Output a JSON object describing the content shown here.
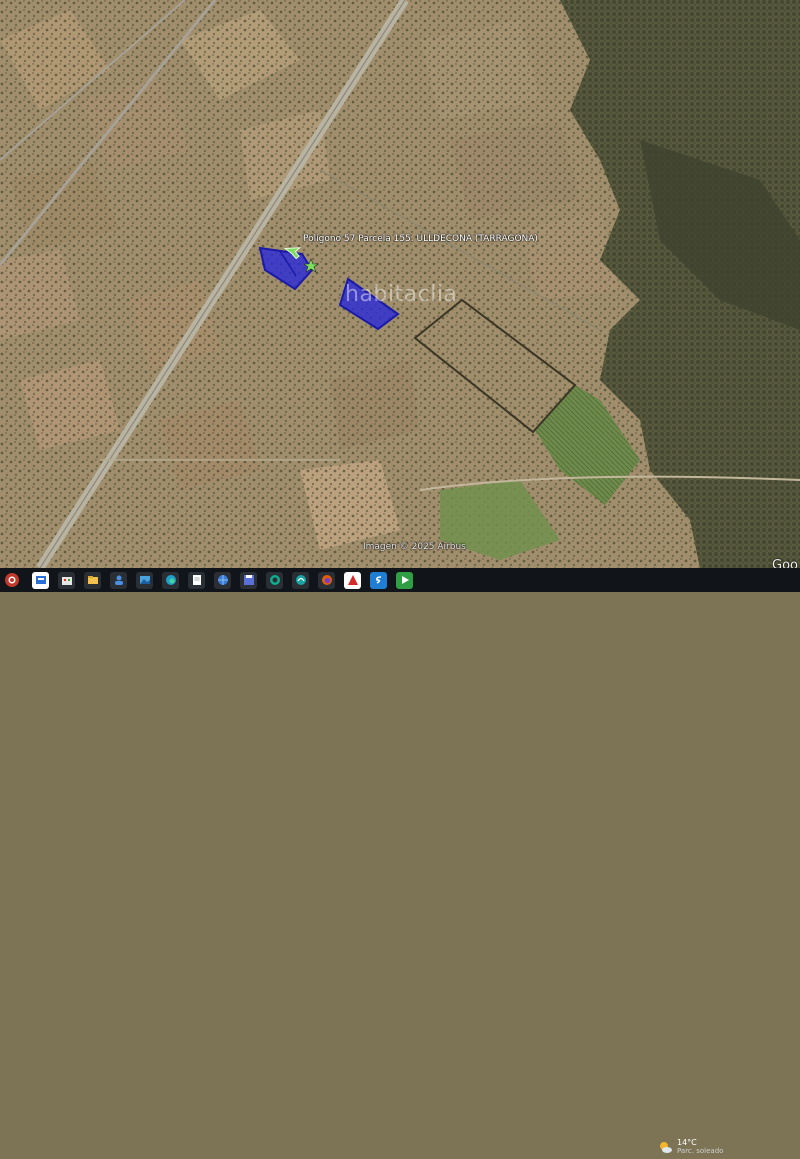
{
  "map": {
    "parcel_label": "Polígono 57 Parcela 155. ULLDECONA (TARRAGONA)",
    "watermark": "habitaclia",
    "imagery_credit": "Imagen © 2025 Airbus",
    "provider_mark": "Goo",
    "parcel_fill_color": "#2b2bd9",
    "parcel_stroke_color": "#1a1aa8",
    "pointer_color": "#7be05a"
  },
  "taskbar": {
    "icons": [
      "start-icon",
      "file-explorer-icon",
      "store-icon",
      "folder-icon",
      "contacts-icon",
      "photos-icon",
      "edge-icon",
      "document-icon",
      "globe-icon",
      "save-icon",
      "webex-icon",
      "chrome-like-icon",
      "firefox-icon",
      "acrobat-icon",
      "sway-icon",
      "project-icon"
    ],
    "weather": {
      "temperature": "14°C",
      "condition": "Parc. soleado"
    }
  }
}
